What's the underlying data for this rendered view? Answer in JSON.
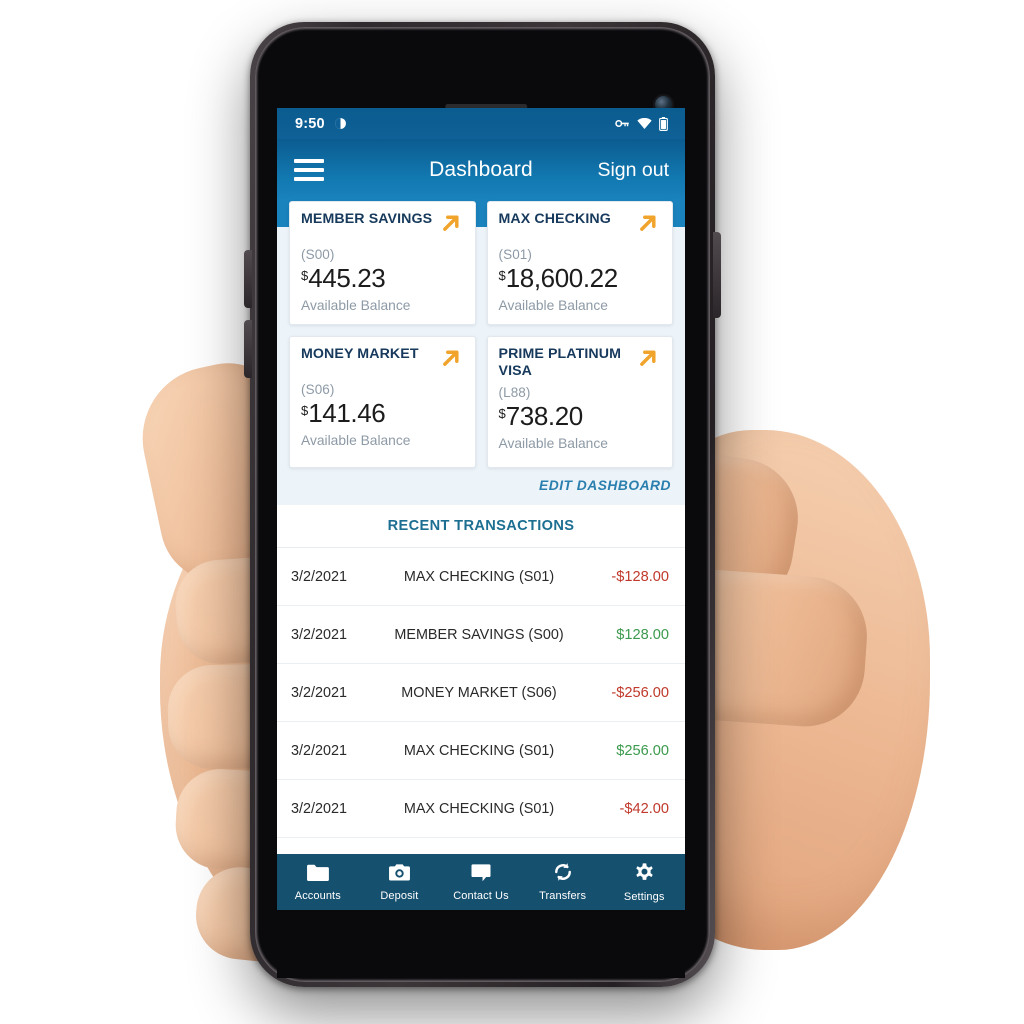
{
  "status_bar": {
    "time": "9:50",
    "icons": [
      "do-not-disturb-icon",
      "vpn-key-icon",
      "wifi-icon",
      "battery-icon"
    ]
  },
  "app_bar": {
    "menu_icon": "hamburger-menu-icon",
    "title": "Dashboard",
    "sign_out_label": "Sign out"
  },
  "accounts": {
    "cards": [
      {
        "title": "MEMBER SAVINGS",
        "number": "(S00)",
        "currency": "$",
        "amount": "445.23",
        "caption": "Available Balance",
        "link_icon": "arrow-up-right-icon"
      },
      {
        "title": "MAX CHECKING",
        "number": "(S01)",
        "currency": "$",
        "amount": "18,600.22",
        "caption": "Available Balance",
        "link_icon": "arrow-up-right-icon"
      },
      {
        "title": "MONEY MARKET",
        "number": "(S06)",
        "currency": "$",
        "amount": "141.46",
        "caption": "Available Balance",
        "link_icon": "arrow-up-right-icon"
      },
      {
        "title": "PRIME PLATINUM VISA",
        "number": "(L88)",
        "currency": "$",
        "amount": "738.20",
        "caption": "Available Balance",
        "link_icon": "arrow-up-right-icon"
      }
    ],
    "edit_label": "EDIT DASHBOARD"
  },
  "transactions": {
    "header": "RECENT TRANSACTIONS",
    "rows": [
      {
        "date": "3/2/2021",
        "account": "MAX CHECKING (S01)",
        "amount": "-$128.00",
        "sign": "neg"
      },
      {
        "date": "3/2/2021",
        "account": "MEMBER SAVINGS (S00)",
        "amount": "$128.00",
        "sign": "pos"
      },
      {
        "date": "3/2/2021",
        "account": "MONEY MARKET (S06)",
        "amount": "-$256.00",
        "sign": "neg"
      },
      {
        "date": "3/2/2021",
        "account": "MAX CHECKING (S01)",
        "amount": "$256.00",
        "sign": "pos"
      },
      {
        "date": "3/2/2021",
        "account": "MAX CHECKING (S01)",
        "amount": "-$42.00",
        "sign": "neg"
      }
    ]
  },
  "bottom_nav": {
    "items": [
      {
        "label": "Accounts",
        "icon": "folder-icon"
      },
      {
        "label": "Deposit",
        "icon": "camera-icon"
      },
      {
        "label": "Contact Us",
        "icon": "speech-bubble-icon"
      },
      {
        "label": "Transfers",
        "icon": "refresh-sync-icon"
      },
      {
        "label": "Settings",
        "icon": "gear-icon"
      }
    ]
  },
  "colors": {
    "header_blue_top": "#0b5c90",
    "header_blue_bottom": "#1a82bd",
    "nav_navy": "#16506f",
    "accent_orange": "#f0a42c",
    "card_title_navy": "#16395c",
    "section_teal": "#1d6f92",
    "negative_red": "#c0392b",
    "positive_green": "#3c9a4e",
    "page_bg": "#edf4f9"
  }
}
